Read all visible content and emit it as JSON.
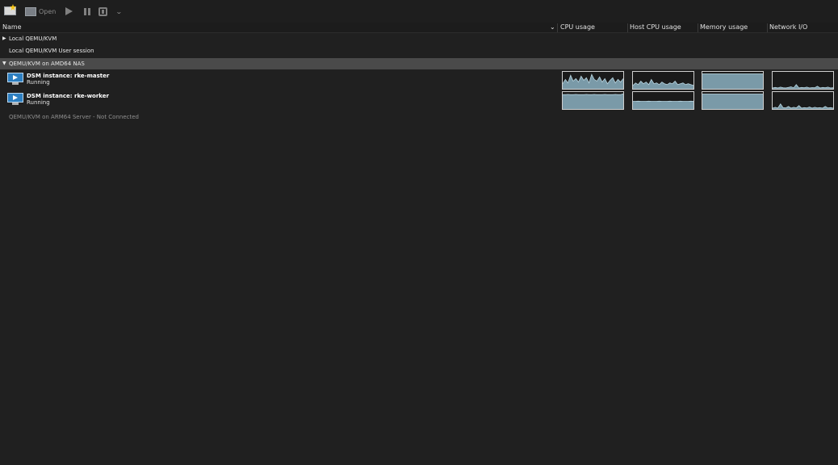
{
  "toolbar": {
    "new_icon": "new-vm-icon",
    "open_label": "Open",
    "open_icon": "monitor-icon",
    "run_icon": "play-icon",
    "pause_icon": "pause-icon",
    "shutdown_icon": "shutdown-icon",
    "menu_icon": "chevron-down-icon"
  },
  "columns": {
    "name": "Name",
    "sort_indicator": "⌄",
    "cpu": "CPU usage",
    "host_cpu": "Host CPU usage",
    "memory": "Memory usage",
    "network": "Network I/O"
  },
  "connections": [
    {
      "label": "Local QEMU/KVM",
      "expanded": false
    },
    {
      "label": "Local QEMU/KVM User session"
    },
    {
      "label": "QEMU/KVM on AMD64 NAS",
      "expanded": true,
      "selected": true
    },
    {
      "label": "QEMU/KVM on ARM64 Server - Not Connected"
    }
  ],
  "vms": [
    {
      "name": "DSM instance: rke-master",
      "status": "Running",
      "graphs": {
        "cpu": [
          0.3,
          0.55,
          0.35,
          0.8,
          0.45,
          0.6,
          0.4,
          0.75,
          0.5,
          0.65,
          0.35,
          0.85,
          0.55,
          0.45,
          0.7,
          0.4,
          0.6,
          0.3,
          0.5,
          0.65,
          0.35,
          0.55,
          0.4,
          0.6
        ],
        "host_cpu": [
          0.2,
          0.35,
          0.25,
          0.45,
          0.3,
          0.4,
          0.25,
          0.55,
          0.3,
          0.35,
          0.25,
          0.4,
          0.3,
          0.25,
          0.35,
          0.3,
          0.45,
          0.25,
          0.3,
          0.35,
          0.25,
          0.3,
          0.25,
          0.2
        ],
        "memory": [
          0.88,
          0.88,
          0.88,
          0.88,
          0.88,
          0.88,
          0.88,
          0.88,
          0.88,
          0.88,
          0.88,
          0.88,
          0.88,
          0.88,
          0.88,
          0.88,
          0.88,
          0.88,
          0.88,
          0.88,
          0.88,
          0.88,
          0.88,
          0.88
        ],
        "network": [
          0.05,
          0.08,
          0.05,
          0.1,
          0.06,
          0.05,
          0.08,
          0.12,
          0.06,
          0.25,
          0.05,
          0.08,
          0.06,
          0.1,
          0.05,
          0.07,
          0.06,
          0.15,
          0.05,
          0.08,
          0.06,
          0.1,
          0.05,
          0.06
        ]
      }
    },
    {
      "name": "DSM instance: rke-worker",
      "status": "Running",
      "graphs": {
        "cpu": [
          0.85,
          0.85,
          0.86,
          0.85,
          0.85,
          0.86,
          0.85,
          0.85,
          0.85,
          0.86,
          0.85,
          0.85,
          0.86,
          0.85,
          0.85,
          0.85,
          0.86,
          0.85,
          0.85,
          0.85,
          0.86,
          0.85,
          0.85,
          0.9
        ],
        "host_cpu": [
          0.45,
          0.45,
          0.46,
          0.45,
          0.45,
          0.45,
          0.46,
          0.45,
          0.45,
          0.45,
          0.46,
          0.45,
          0.45,
          0.45,
          0.46,
          0.45,
          0.45,
          0.45,
          0.46,
          0.45,
          0.45,
          0.45,
          0.46,
          0.45
        ],
        "memory": [
          0.88,
          0.88,
          0.88,
          0.88,
          0.88,
          0.88,
          0.88,
          0.88,
          0.88,
          0.88,
          0.88,
          0.88,
          0.88,
          0.88,
          0.88,
          0.88,
          0.88,
          0.88,
          0.88,
          0.88,
          0.88,
          0.88,
          0.88,
          0.88
        ],
        "network": [
          0.05,
          0.1,
          0.05,
          0.3,
          0.08,
          0.06,
          0.15,
          0.05,
          0.1,
          0.06,
          0.2,
          0.05,
          0.08,
          0.06,
          0.12,
          0.05,
          0.1,
          0.06,
          0.08,
          0.05,
          0.15,
          0.06,
          0.08,
          0.05
        ]
      }
    }
  ],
  "colors": {
    "graph_fill": "#7a9aa8",
    "graph_line": "#b8d4df",
    "graph_bg": "#1a1a1a"
  }
}
